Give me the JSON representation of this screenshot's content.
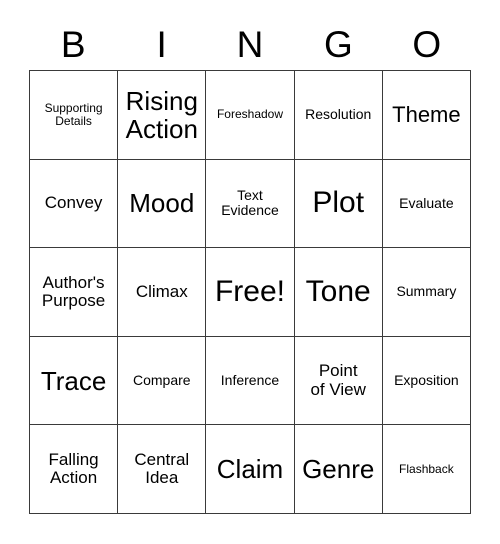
{
  "header": {
    "letters": [
      "B",
      "I",
      "N",
      "G",
      "O"
    ]
  },
  "grid": {
    "rows": 5,
    "columns": 5,
    "border_color": "#3a3a3a",
    "background_color": "#ffffff",
    "text_color": "#000000",
    "cells": [
      [
        {
          "label": "Supporting\nDetails",
          "size": "xxs"
        },
        {
          "label": "Rising\nAction",
          "size": "lg"
        },
        {
          "label": "Foreshadow",
          "size": "xxs"
        },
        {
          "label": "Resolution",
          "size": "xs"
        },
        {
          "label": "Theme",
          "size": "md"
        }
      ],
      [
        {
          "label": "Convey",
          "size": "sm"
        },
        {
          "label": "Mood",
          "size": "lg"
        },
        {
          "label": "Text\nEvidence",
          "size": "xs"
        },
        {
          "label": "Plot",
          "size": "xl"
        },
        {
          "label": "Evaluate",
          "size": "xs"
        }
      ],
      [
        {
          "label": "Author's\nPurpose",
          "size": "sm"
        },
        {
          "label": "Climax",
          "size": "sm"
        },
        {
          "label": "Free!",
          "size": "xl"
        },
        {
          "label": "Tone",
          "size": "xl"
        },
        {
          "label": "Summary",
          "size": "xs"
        }
      ],
      [
        {
          "label": "Trace",
          "size": "lg"
        },
        {
          "label": "Compare",
          "size": "xs"
        },
        {
          "label": "Inference",
          "size": "xs"
        },
        {
          "label": "Point\nof View",
          "size": "sm"
        },
        {
          "label": "Exposition",
          "size": "xs"
        }
      ],
      [
        {
          "label": "Falling\nAction",
          "size": "sm"
        },
        {
          "label": "Central\nIdea",
          "size": "sm"
        },
        {
          "label": "Claim",
          "size": "lg"
        },
        {
          "label": "Genre",
          "size": "lg"
        },
        {
          "label": "Flashback",
          "size": "xxs"
        }
      ]
    ]
  }
}
